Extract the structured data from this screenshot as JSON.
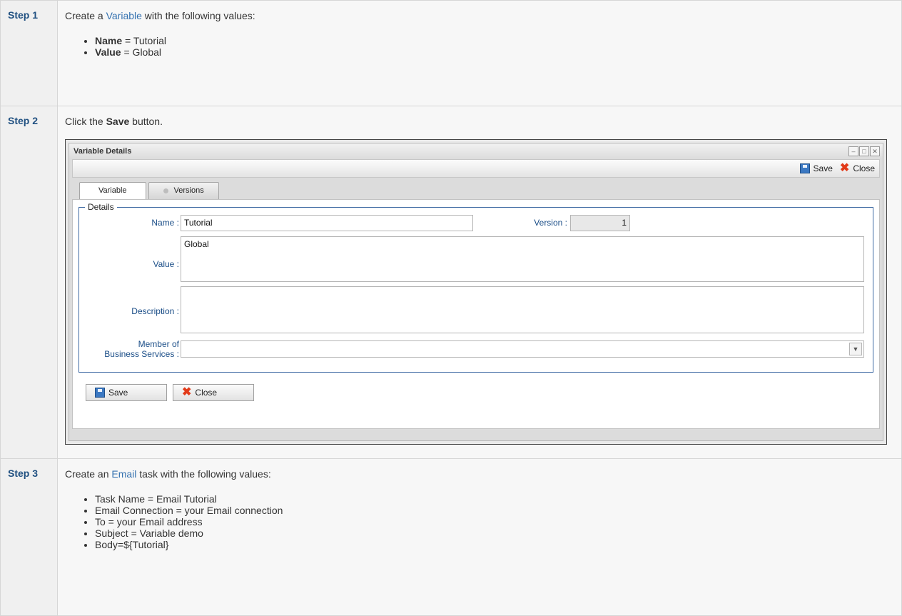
{
  "steps": [
    {
      "label": "Step 1",
      "text_before": "Create a ",
      "link": "Variable",
      "text_after": " with the following values:",
      "items": [
        {
          "key": "Name",
          "value": " = Tutorial"
        },
        {
          "key": "Value",
          "value": " = Global"
        }
      ]
    },
    {
      "label": "Step 2",
      "text_before": "Click the ",
      "bold": "Save",
      "text_after": " button."
    },
    {
      "label": "Step 3",
      "text_before": "Create an ",
      "link": "Email",
      "text_after": " task with the following values:",
      "items": [
        "Task Name = Email Tutorial",
        "Email Connection = your Email connection",
        "To = your Email address",
        "Subject = Variable demo",
        "Body=${Tutorial}"
      ]
    }
  ],
  "dialog": {
    "title": "Variable Details",
    "window_controls": [
      "–",
      "□",
      "✕"
    ],
    "toolbar": {
      "save_label": "Save",
      "close_label": "Close"
    },
    "tabs": [
      "Variable",
      "Versions"
    ],
    "legend": "Details",
    "fields": {
      "name_label": "Name :",
      "name_value": "Tutorial",
      "version_label": "Version :",
      "version_value": "1",
      "value_label": "Value :",
      "value_value": "Global",
      "description_label": "Description :",
      "description_value": "",
      "member_label_1": "Member of",
      "member_label_2": "Business Services :",
      "member_value": ""
    },
    "buttons": {
      "save_label": "Save",
      "close_label": "Close"
    }
  },
  "icons": {
    "save": "save-icon",
    "close": "close-x-icon",
    "dropdown": "chevron-down-icon"
  },
  "colors": {
    "link": "#3572b0",
    "step_label": "#205081",
    "field_label": "#1a4d87",
    "close_icon": "#e23b1a"
  }
}
